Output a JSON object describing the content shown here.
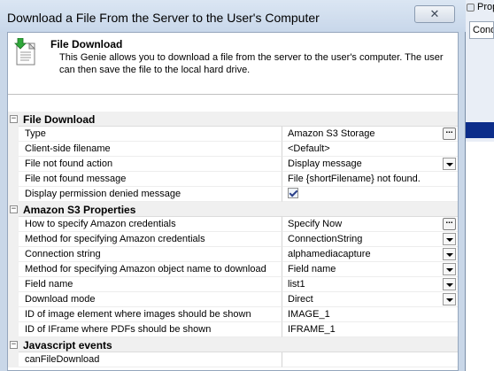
{
  "background": {
    "tab_label": "Prop",
    "field_value": "Condi"
  },
  "window": {
    "title": "Download a File From the Server to the User's Computer",
    "close_label": "✕"
  },
  "header": {
    "title": "File Download",
    "description": "This Genie allows you to download a file from the server to the user's computer. The user can then save the file to the local hard drive."
  },
  "grid": {
    "rows": [
      {
        "type": "category",
        "label": "File Download",
        "toggle": "−"
      },
      {
        "type": "prop",
        "label": "Type",
        "value": "Amazon S3 Storage",
        "editor": "ellipsis"
      },
      {
        "type": "prop",
        "label": "Client-side filename",
        "value": "<Default>",
        "editor": "none"
      },
      {
        "type": "prop",
        "label": "File not found action",
        "value": "Display message",
        "editor": "dropdown"
      },
      {
        "type": "prop",
        "label": "File not found message",
        "value": "File {shortFilename} not found.",
        "editor": "none"
      },
      {
        "type": "prop",
        "label": "Display permission denied message",
        "value": "",
        "editor": "checkbox",
        "checked": true
      },
      {
        "type": "category",
        "label": "Amazon S3 Properties",
        "toggle": "−"
      },
      {
        "type": "prop",
        "label": "How to specify Amazon credentials",
        "value": "Specify Now",
        "editor": "ellipsis"
      },
      {
        "type": "prop",
        "label": "Method for specifying Amazon credentials",
        "value": "ConnectionString",
        "editor": "dropdown"
      },
      {
        "type": "prop",
        "label": "Connection string",
        "value": "alphamediacapture",
        "editor": "dropdown"
      },
      {
        "type": "prop",
        "label": "Method for specifying Amazon object name to download",
        "value": "Field name",
        "editor": "dropdown"
      },
      {
        "type": "prop",
        "label": "Field name",
        "value": "list1",
        "editor": "dropdown"
      },
      {
        "type": "prop",
        "label": "Download mode",
        "value": "Direct",
        "editor": "dropdown"
      },
      {
        "type": "prop",
        "label": "ID of image element where images should be shown",
        "value": "IMAGE_1",
        "editor": "none"
      },
      {
        "type": "prop",
        "label": "ID of IFrame where PDFs should be shown",
        "value": "IFRAME_1",
        "editor": "none"
      },
      {
        "type": "category",
        "label": "Javascript events",
        "toggle": "−"
      },
      {
        "type": "prop",
        "label": "canFileDownload",
        "value": "",
        "editor": "none"
      }
    ]
  },
  "colors": {
    "category_bg": "#f0f0f0",
    "titlebar": "#dbe6f3",
    "selection_bar": "#0c2d8a"
  }
}
